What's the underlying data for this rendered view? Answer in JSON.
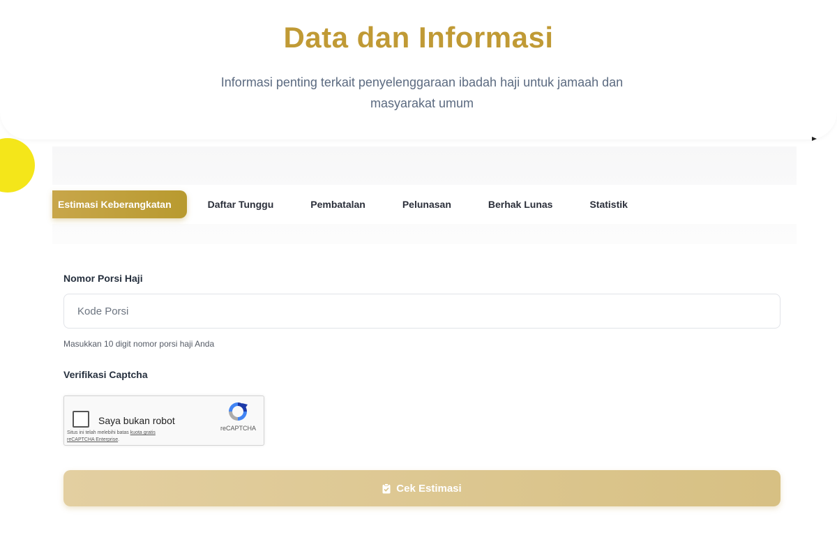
{
  "hero": {
    "title": "Data dan Informasi",
    "subtitle": "Informasi penting terkait penyelenggaraan ibadah haji untuk jamaah dan masyarakat umum"
  },
  "tabs": [
    {
      "label": "Estimasi Keberangkatan",
      "active": true
    },
    {
      "label": "Daftar Tunggu",
      "active": false
    },
    {
      "label": "Pembatalan",
      "active": false
    },
    {
      "label": "Pelunasan",
      "active": false
    },
    {
      "label": "Berhak Lunas",
      "active": false
    },
    {
      "label": "Statistik",
      "active": false
    }
  ],
  "form": {
    "porsi_label": "Nomor Porsi Haji",
    "porsi_placeholder": "Kode Porsi",
    "porsi_value": "",
    "porsi_hint": "Masukkan 10 digit nomor porsi haji Anda",
    "captcha_label": "Verifikasi Captcha",
    "submit_label": "Cek Estimasi"
  },
  "recaptcha": {
    "checkbox_label": "Saya bukan robot",
    "note_prefix": "Situs ini telah melebihi batas ",
    "note_link1": "kuota gratis",
    "note_link2": "reCAPTCHA Enterprise",
    "note_suffix": ".",
    "brand": "reCAPTCHA",
    "checked": false
  },
  "colors": {
    "accent_gold": "#c09a35",
    "subtitle_text": "#5b6a80",
    "button_start": "#e3cfa1",
    "button_end": "#d7c083"
  },
  "icons": {
    "submit": "clipboard-check-icon",
    "captcha_logo": "recaptcha-logo-icon"
  }
}
